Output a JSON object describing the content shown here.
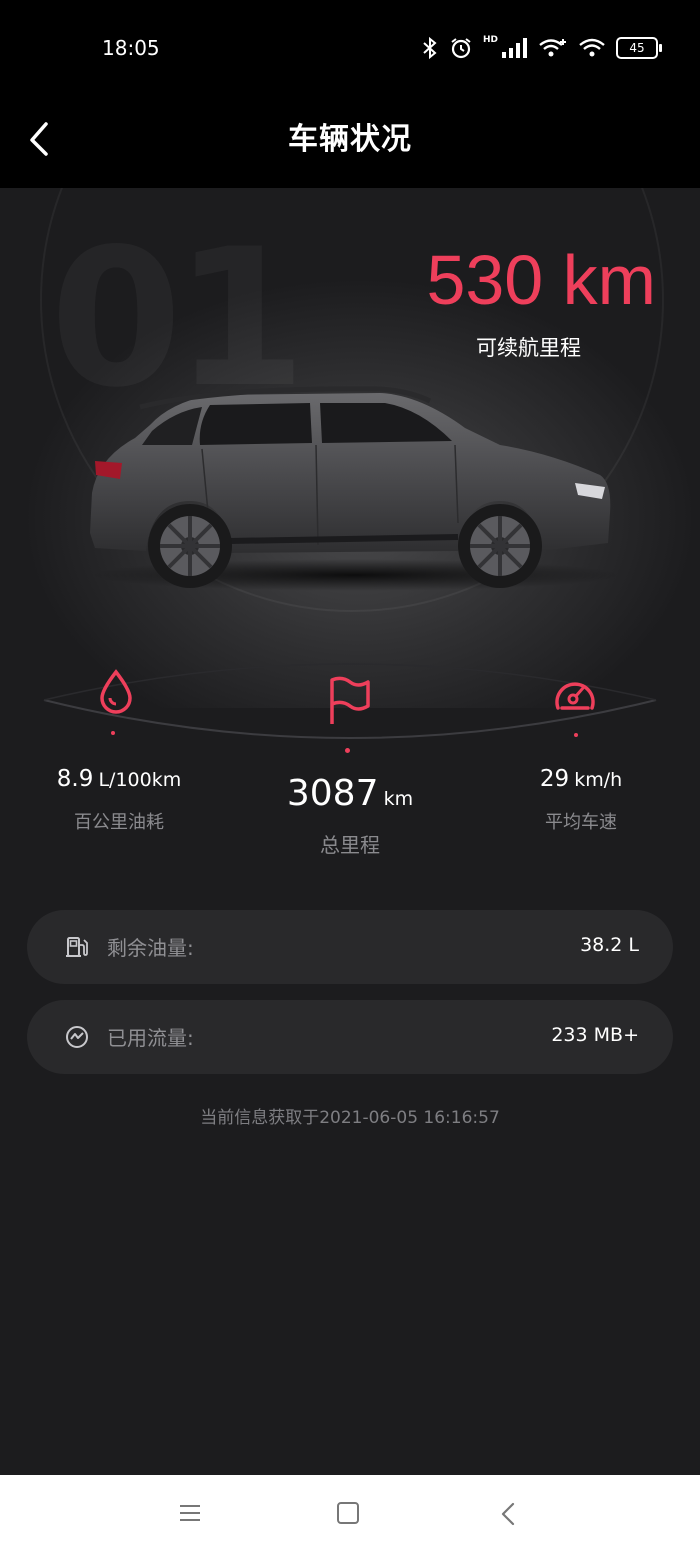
{
  "status_bar": {
    "time": "18:05",
    "battery": "45",
    "hd_label": "HD"
  },
  "header": {
    "title": "车辆状况"
  },
  "range": {
    "value": "530 km",
    "label": "可续航里程"
  },
  "stats": [
    {
      "value": "8.9",
      "unit": "L/100km",
      "label": "百公里油耗",
      "icon": "drop-icon"
    },
    {
      "value": "3087",
      "unit": "km",
      "label": "总里程",
      "icon": "flag-icon"
    },
    {
      "value": "29",
      "unit": "km/h",
      "label": "平均车速",
      "icon": "speedometer-icon"
    }
  ],
  "info": [
    {
      "label": "剩余油量:",
      "value": "38.2 L",
      "icon": "fuel-pump-icon"
    },
    {
      "label": "已用流量:",
      "value": "233 MB+",
      "icon": "data-usage-icon"
    }
  ],
  "updated_text": "当前信息获取于2021-06-05 16:16:57",
  "colors": {
    "accent": "#ee3f5b",
    "background": "#1c1c1e",
    "card": "#29292b"
  }
}
